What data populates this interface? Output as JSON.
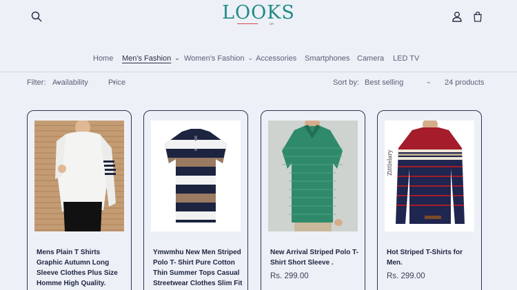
{
  "header": {
    "logo_text": "LOOKS",
    "logo_sub": "OR"
  },
  "nav": {
    "items": [
      {
        "label": "Home"
      },
      {
        "label": "Men's Fashion"
      },
      {
        "label": "Women's Fashion"
      },
      {
        "label": "Accessories"
      },
      {
        "label": "Smartphones"
      },
      {
        "label": "Camera"
      },
      {
        "label": "LED TV"
      }
    ]
  },
  "filters": {
    "filter_label": "Filter:",
    "availability": "Availability",
    "price": "Price",
    "sort_label": "Sort by:",
    "sort_value": "Best selling",
    "count": "24 products"
  },
  "products": [
    {
      "title": "Mens Plain T Shirts Graphic Autumn Long Sleeve Clothes Plus Size Homme High Quality.",
      "price": ""
    },
    {
      "title": "Ymwmhu New Men Striped Polo T- Shirt Pure Cotton Thin Summer Tops Casual Streetwear Clothes Slim Fit Casual Polo Shirt Men",
      "price": ""
    },
    {
      "title": "New Arrival Striped Polo T-Shirt Short Sleeve .",
      "price": "Rs. 299.00"
    },
    {
      "title": "Hot Striped T-Shirts for Men.",
      "price": "Rs. 299.00"
    }
  ],
  "colors": {
    "brand": "#1f8a86",
    "background": "#edf0f7",
    "text": "#2a3045"
  },
  "icons": {
    "search": "search-icon",
    "account": "user-icon",
    "cart": "cart-icon",
    "chevron": "chevron-down-icon"
  }
}
